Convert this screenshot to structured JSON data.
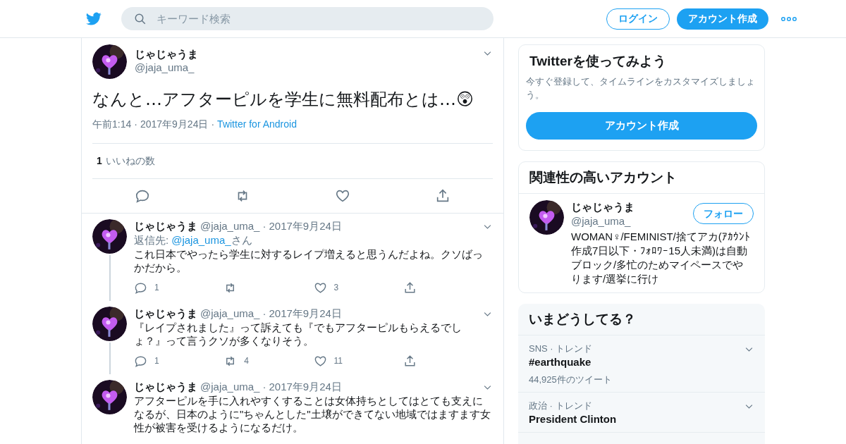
{
  "header": {
    "search": {
      "placeholder": "キーワード検索"
    },
    "login": "ログイン",
    "signup": "アカウント作成"
  },
  "tweet": {
    "name": "じゃじゃうま",
    "handle": "@jaja_uma_",
    "text": "なんと…アフターピルを学生に無料配布とは…😲",
    "time": "午前1:14",
    "separator": "·",
    "date": "2017年9月24日",
    "source": "Twitter for Android",
    "likes_count": "1",
    "likes_label": "いいねの数"
  },
  "replies": [
    {
      "name": "じゃじゃうま",
      "handle": "@jaja_uma_",
      "date": "2017年9月24日",
      "separator": "·",
      "reply_to": {
        "prefix": "返信先:",
        "handle": "@jaja_uma_",
        "suffix": "さん"
      },
      "text": "これ日本でやったら学生に対するレイプ増えると思うんだよね。クソばっかだから。",
      "reply_count": "1",
      "like_count": "3"
    },
    {
      "name": "じゃじゃうま",
      "handle": "@jaja_uma_",
      "date": "2017年9月24日",
      "separator": "·",
      "text": "『レイプされました』って訴えても『でもアフターピルもらえるでしょ？』って言うクソが多くなりそう。",
      "reply_count": "1",
      "retweet_count": "4",
      "like_count": "11"
    },
    {
      "name": "じゃじゃうま",
      "handle": "@jaja_uma_",
      "date": "2017年9月24日",
      "separator": "·",
      "text": "アフターピルを手に入れやすくすることは女体持ちとしてはとても支えになるが、日本のように\"ちゃんとした\"土壌ができてない地域ではますます女性が被害を受けるようになるだけ。"
    }
  ],
  "signup_card": {
    "title": "Twitterを使ってみよう",
    "description": "今すぐ登録して、タイムラインをカスタマイズしましょう。",
    "button": "アカウント作成"
  },
  "related": {
    "title": "関連性の高いアカウント",
    "accounts": [
      {
        "name": "じゃじゃうま",
        "handle": "@jaja_uma_",
        "follow": "フォロー",
        "bio": "WOMAN♀/FEMINIST/捨てアカ(ｱｶｳﾝﾄ作成7日以下・ﾌｫﾛﾜｰ15人未満)は自動ブロック/多忙のためマイペースでやります/選挙に行け"
      }
    ]
  },
  "trends": {
    "title": "いまどうしてる？",
    "items": [
      {
        "context": "SNS · トレンド",
        "name": "#earthquake",
        "count": "44,925件のツイート"
      },
      {
        "context": "政治 · トレンド",
        "name": "President Clinton"
      }
    ]
  }
}
